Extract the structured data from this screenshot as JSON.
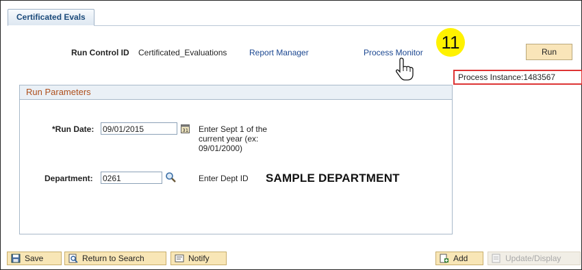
{
  "tab": {
    "label": "Certificated Evals"
  },
  "run_control": {
    "label": "Run Control ID",
    "value": "Certificated_Evaluations"
  },
  "links": {
    "report_manager": "Report Manager",
    "process_monitor": "Process Monitor"
  },
  "callout": {
    "number": "11"
  },
  "run_button": {
    "label": "Run"
  },
  "process_instance": {
    "text": "Process Instance:1483567"
  },
  "panel": {
    "title": "Run Parameters",
    "run_date": {
      "label": "*Run Date:",
      "value": "09/01/2015",
      "help_lines": [
        "Enter Sept 1 of the",
        "current year (ex:",
        "09/01/2000)"
      ]
    },
    "department": {
      "label": "Department:",
      "value": "0261",
      "help": "Enter Dept ID",
      "description": "SAMPLE DEPARTMENT"
    }
  },
  "toolbar": {
    "save": "Save",
    "return_to_search": "Return to Search",
    "notify": "Notify",
    "add": "Add",
    "update_display": "Update/Display"
  }
}
